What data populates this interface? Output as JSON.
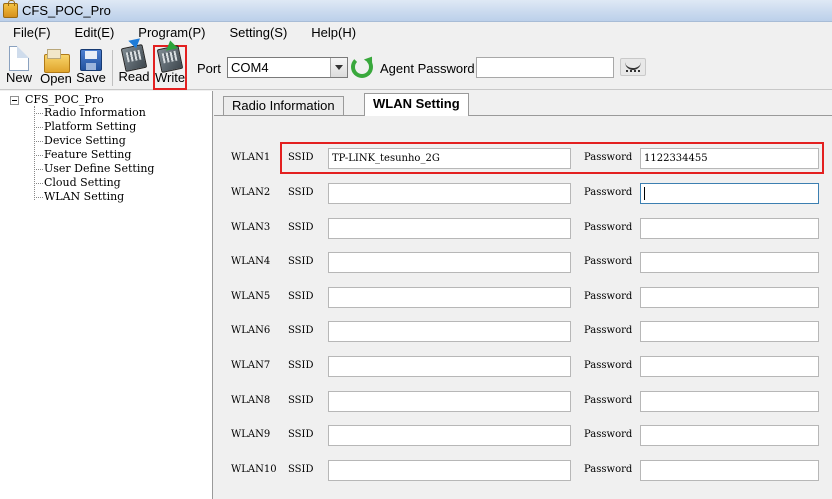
{
  "window": {
    "title": "CFS_POC_Pro"
  },
  "menu": [
    "File(F)",
    "Edit(E)",
    "Program(P)",
    "Setting(S)",
    "Help(H)"
  ],
  "toolbar": {
    "new_label": "New",
    "open_label": "Open",
    "save_label": "Save",
    "read_label": "Read",
    "write_label": "Write",
    "port_label": "Port",
    "port_value": "COM4",
    "agent_password_label": "Agent Password",
    "agent_password_value": ""
  },
  "tree": {
    "root": "CFS_POC_Pro",
    "items": [
      "Radio Information",
      "Platform Setting",
      "Device Setting",
      "Feature Setting",
      "User Define Setting",
      "Cloud Setting",
      "WLAN Setting"
    ]
  },
  "tabs": [
    "Radio Information",
    "WLAN Setting"
  ],
  "active_tab": "WLAN Setting",
  "wlan": {
    "ssid_label": "SSID",
    "password_label": "Password",
    "rows": [
      {
        "label": "WLAN1",
        "ssid": "TP-LINK_tesunho_2G",
        "password": "1122334455"
      },
      {
        "label": "WLAN2",
        "ssid": "",
        "password": ""
      },
      {
        "label": "WLAN3",
        "ssid": "",
        "password": ""
      },
      {
        "label": "WLAN4",
        "ssid": "",
        "password": ""
      },
      {
        "label": "WLAN5",
        "ssid": "",
        "password": ""
      },
      {
        "label": "WLAN6",
        "ssid": "",
        "password": ""
      },
      {
        "label": "WLAN7",
        "ssid": "",
        "password": ""
      },
      {
        "label": "WLAN8",
        "ssid": "",
        "password": ""
      },
      {
        "label": "WLAN9",
        "ssid": "",
        "password": ""
      },
      {
        "label": "WLAN10",
        "ssid": "",
        "password": ""
      }
    ]
  },
  "colors": {
    "highlight": "#e32020",
    "focus_border": "#3c7fb1"
  }
}
